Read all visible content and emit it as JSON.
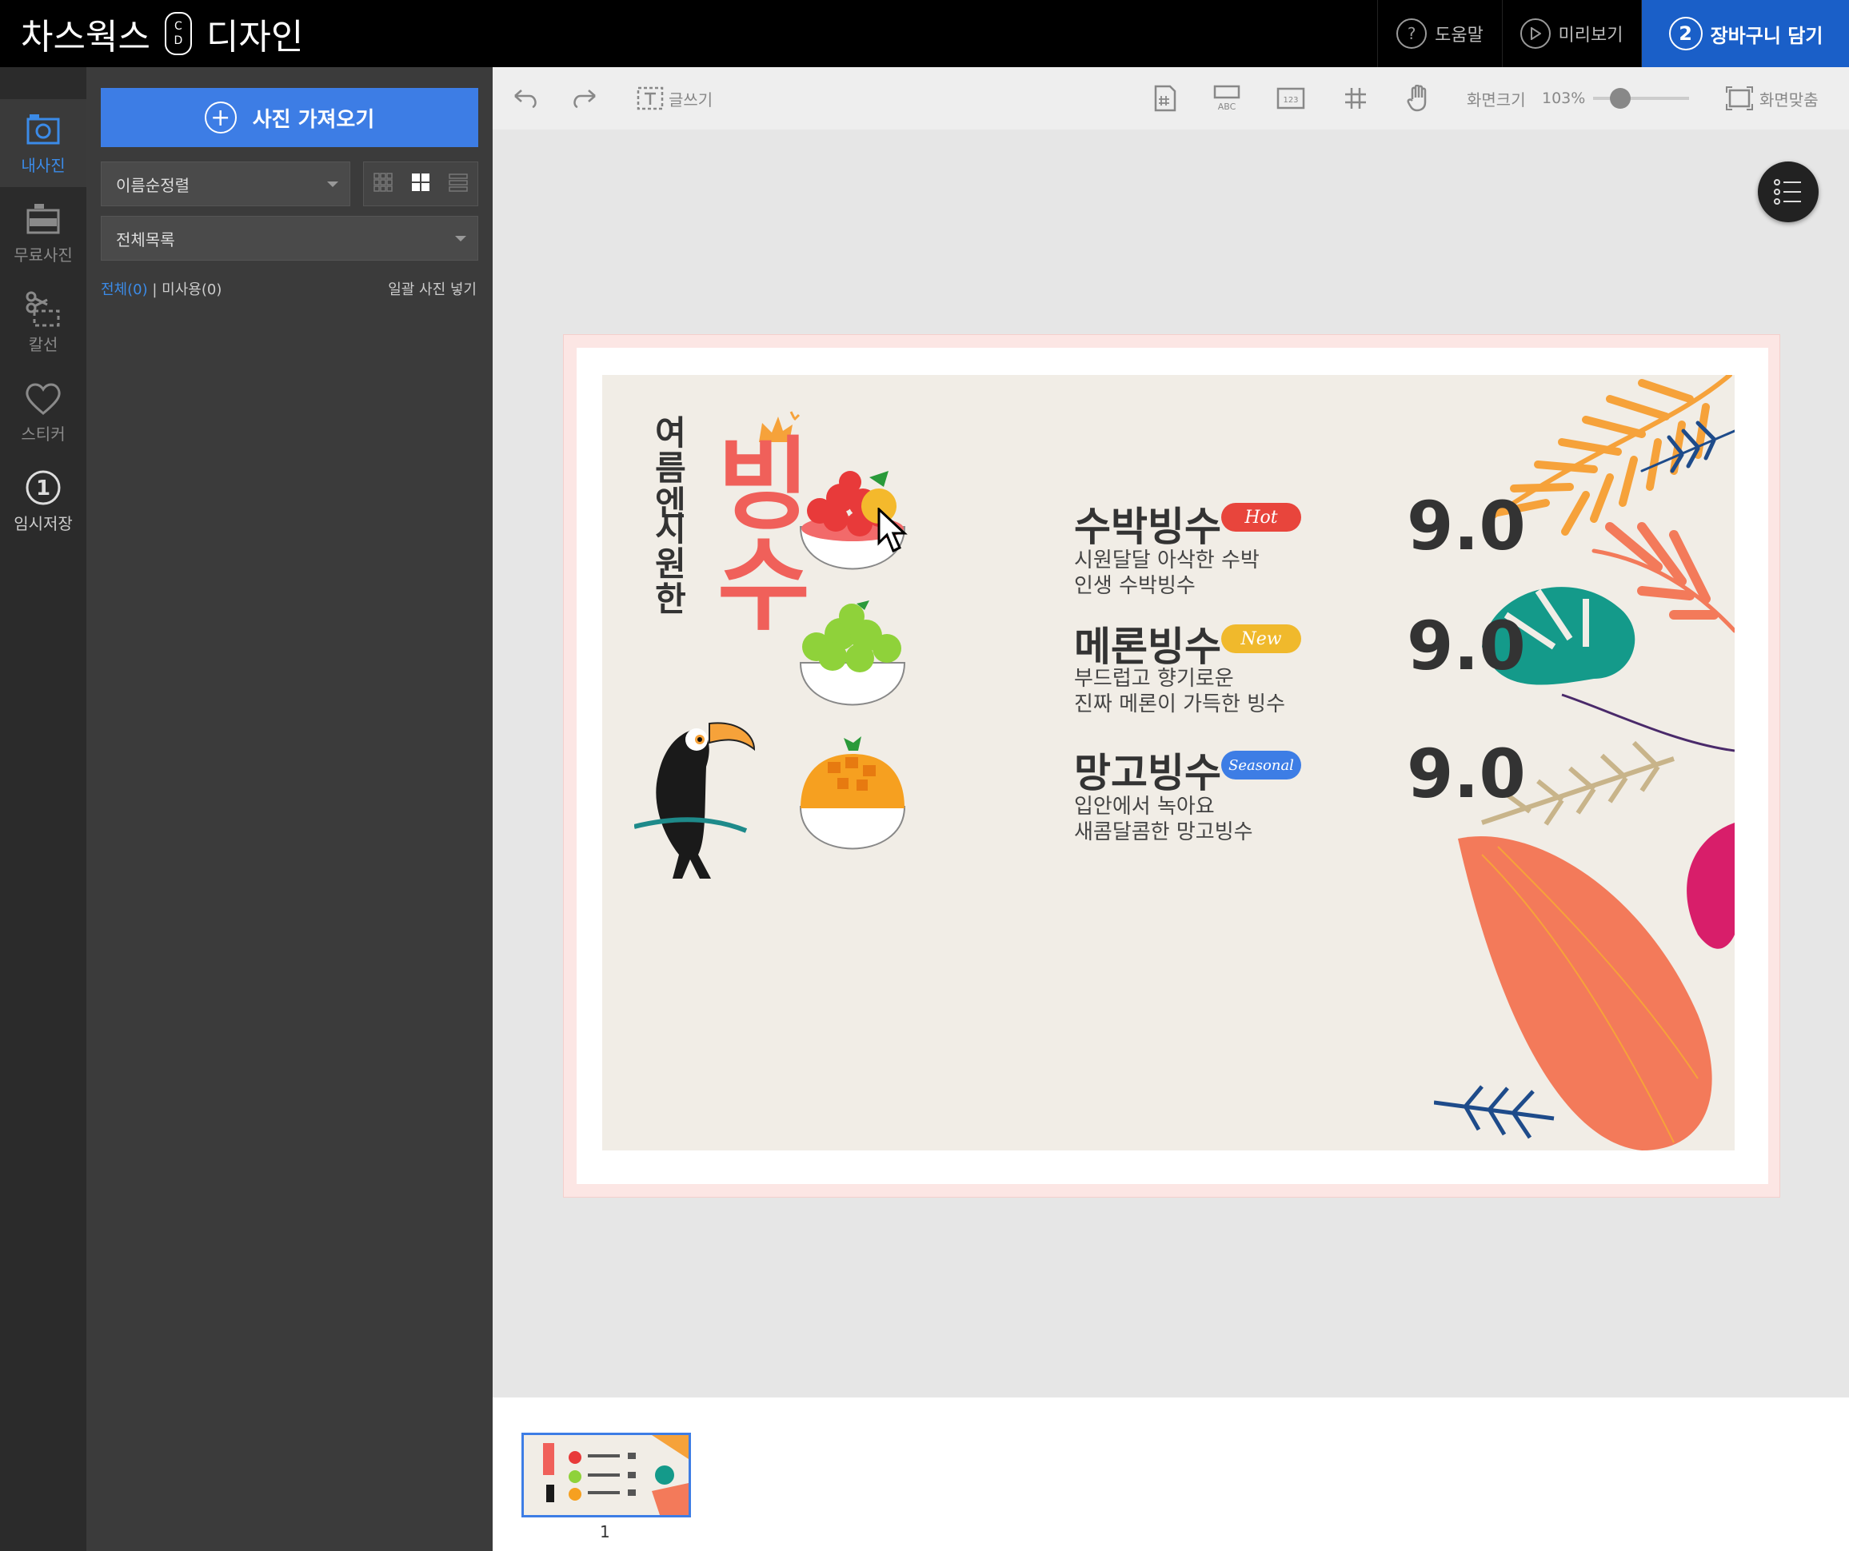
{
  "app": {
    "brand_left": "차스웍스",
    "brand_mark_top": "C",
    "brand_mark_bottom": "D",
    "brand_right": "디자인"
  },
  "topbar": {
    "help": "도움말",
    "help_icon_glyph": "?",
    "preview": "미리보기",
    "cart_step": "2",
    "cart": "장바구니 담기"
  },
  "rail": {
    "items": [
      {
        "label": "내사진",
        "icon": "photo-icon"
      },
      {
        "label": "무료사진",
        "icon": "free-photo-icon"
      },
      {
        "label": "칼선",
        "icon": "scissors-icon"
      },
      {
        "label": "스티커",
        "icon": "heart-icon"
      },
      {
        "label": "임시저장",
        "icon": "temp-save-icon",
        "step": "1"
      }
    ]
  },
  "panel": {
    "import_button": "사진 가져오기",
    "sort_value": "이름순정렬",
    "list_value": "전체목록",
    "filter_all": "전체(0)",
    "filter_sep": "|",
    "filter_unused": "미사용(0)",
    "bulk_insert": "일괄 사진 넣기"
  },
  "toolbar": {
    "text_tool": "글쓰기",
    "abc_label": "ABC",
    "num_label": "123",
    "zoom_label": "화면크기",
    "zoom_value": "103%",
    "zoom_fraction": 0.28,
    "fit_label": "화면맞춤"
  },
  "design": {
    "vertical_line1": "여름엔",
    "vertical_line2": "시원한",
    "big_title": "빙수",
    "items": [
      {
        "name": "수박빙수",
        "tag": "Hot",
        "tag_color": "#e8453c",
        "desc1": "시원달달 아삭한 수박",
        "desc2": "인생 수박빙수",
        "price": "9.0"
      },
      {
        "name": "메론빙수",
        "tag": "New",
        "tag_color": "#f0b92c",
        "desc1": "부드럽고 향기로운",
        "desc2": "진짜 메론이 가득한 빙수",
        "price": "9.0"
      },
      {
        "name": "망고빙수",
        "tag": "Seasonal",
        "tag_color": "#3d7de5",
        "desc1": "입안에서 녹아요",
        "desc2": "새콤달콤한 망고빙수",
        "price": "9.0"
      }
    ]
  },
  "pages": {
    "thumb_number": "1"
  },
  "colors": {
    "accent": "#3d7de5",
    "title_red": "#f0605a"
  }
}
